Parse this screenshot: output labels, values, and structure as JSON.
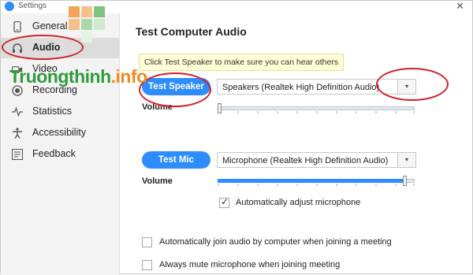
{
  "window": {
    "title": "Settings"
  },
  "sidebar": {
    "items": [
      {
        "label": "General",
        "icon": "phone-settings-icon"
      },
      {
        "label": "Audio",
        "icon": "headphones-icon"
      },
      {
        "label": "Video",
        "icon": "video-camera-icon"
      },
      {
        "label": "Recording",
        "icon": "record-icon"
      },
      {
        "label": "Statistics",
        "icon": "pulse-icon"
      },
      {
        "label": "Accessibility",
        "icon": "accessibility-icon"
      },
      {
        "label": "Feedback",
        "icon": "feedback-icon"
      }
    ],
    "active": "Audio"
  },
  "main": {
    "heading": "Test Computer Audio",
    "tooltip": "Click Test Speaker to make sure you can hear others",
    "speaker": {
      "button_label": "Test Speaker",
      "device": "Speakers (Realtek High Definition Audio)",
      "volume_label": "Volume"
    },
    "mic": {
      "button_label": "Test Mic",
      "device": "Microphone (Realtek High Definition Audio)",
      "volume_label": "Volume",
      "volume_level": 0.95,
      "auto_adjust_label": "Automatically adjust microphone",
      "auto_adjust_checked": true
    },
    "options": [
      {
        "label": "Automatically join audio by computer when joining a meeting",
        "checked": false
      },
      {
        "label": "Always mute microphone when joining meeting",
        "checked": false
      }
    ]
  },
  "watermark": {
    "text": "Truongthinh",
    "suffix": ".info"
  },
  "colors": {
    "accent": "#2d8cff",
    "annotation": "#d21f27",
    "watermark_green": "#2f9c3b",
    "watermark_orange": "#f08a24"
  }
}
